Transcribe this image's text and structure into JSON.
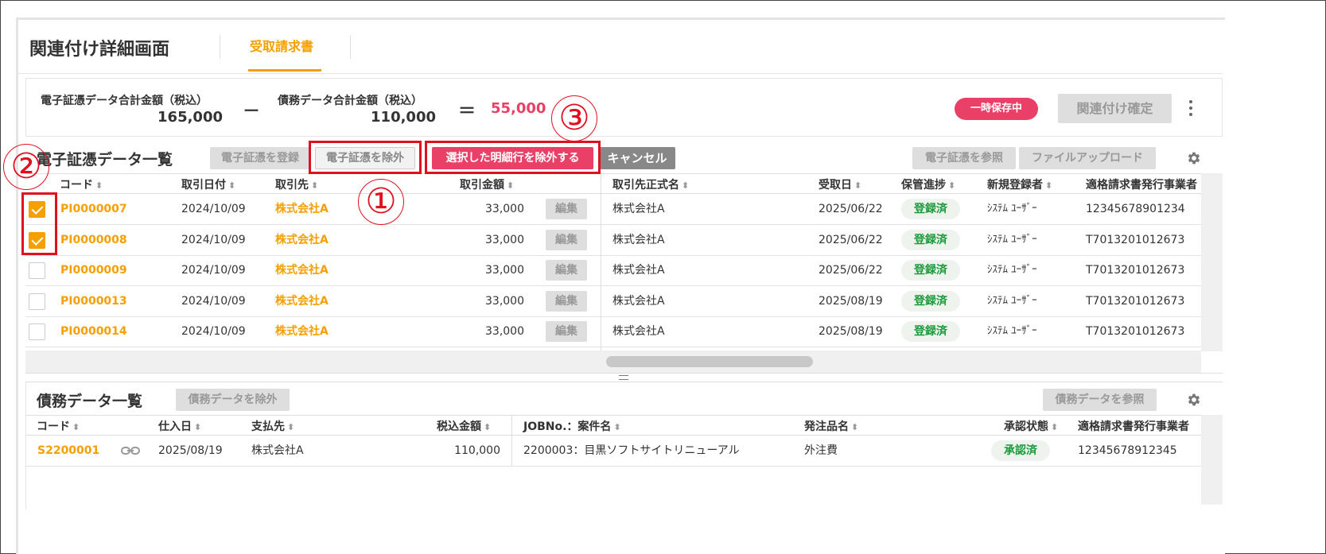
{
  "header": {
    "title": "関連付け詳細画面",
    "tab_label": "受取請求書"
  },
  "summary": {
    "evidence_label": "電子証憑データ合計金額（税込）",
    "evidence_value": "165,000",
    "minus": "－",
    "debt_label": "債務データ合計金額（税込）",
    "debt_value": "110,000",
    "equals": "＝",
    "difference": "55,000",
    "status_badge": "一時保存中",
    "confirm_button": "関連付け確定"
  },
  "evidence": {
    "title": "電子証憑データ一覧",
    "buttons": {
      "register": "電子証憑を登録",
      "exclude": "電子証憑を除外",
      "exclude_selected": "選択した明細行を除外する",
      "cancel": "キャンセル",
      "view": "電子証憑を参照",
      "upload": "ファイルアップロード"
    },
    "columns": [
      "コード",
      "取引日付",
      "取引先",
      "取引金額",
      "取引先正式名",
      "受取日",
      "保管進捗",
      "新規登録者",
      "適格請求書発行事業者"
    ],
    "edit_label": "編集",
    "rows": [
      {
        "checked": true,
        "code": "PI0000007",
        "date": "2024/10/09",
        "partner": "株式会社A",
        "amount": "33,000",
        "official": "株式会社A",
        "received": "2025/06/22",
        "status": "登録済",
        "registrant": "ｼｽﾃﾑ ﾕｰｻﾞｰ",
        "invoice_no": "12345678901234"
      },
      {
        "checked": true,
        "code": "PI0000008",
        "date": "2024/10/09",
        "partner": "株式会社A",
        "amount": "33,000",
        "official": "株式会社A",
        "received": "2025/06/22",
        "status": "登録済",
        "registrant": "ｼｽﾃﾑ ﾕｰｻﾞｰ",
        "invoice_no": "T7013201012673"
      },
      {
        "checked": false,
        "code": "PI0000009",
        "date": "2024/10/09",
        "partner": "株式会社A",
        "amount": "33,000",
        "official": "株式会社A",
        "received": "2025/06/22",
        "status": "登録済",
        "registrant": "ｼｽﾃﾑ ﾕｰｻﾞｰ",
        "invoice_no": "T7013201012673"
      },
      {
        "checked": false,
        "code": "PI0000013",
        "date": "2024/10/09",
        "partner": "株式会社A",
        "amount": "33,000",
        "official": "株式会社A",
        "received": "2025/08/19",
        "status": "登録済",
        "registrant": "ｼｽﾃﾑ ﾕｰｻﾞｰ",
        "invoice_no": "T7013201012673"
      },
      {
        "checked": false,
        "code": "PI0000014",
        "date": "2024/10/09",
        "partner": "株式会社A",
        "amount": "33,000",
        "official": "株式会社A",
        "received": "2025/08/19",
        "status": "登録済",
        "registrant": "ｼｽﾃﾑ ﾕｰｻﾞｰ",
        "invoice_no": "T7013201012673"
      }
    ]
  },
  "debt": {
    "title": "債務データ一覧",
    "buttons": {
      "exclude": "債務データを除外",
      "view": "債務データを参照"
    },
    "columns": [
      "コード",
      "仕入日",
      "支払先",
      "税込金額",
      "JOBNo.：案件名",
      "発注品名",
      "承認状態",
      "適格請求書発行事業者"
    ],
    "rows": [
      {
        "code": "S2200001",
        "date": "2025/08/19",
        "payee": "株式会社A",
        "amount": "110,000",
        "job": "2200003：目黒ソフトサイトリニューアル",
        "item": "外注費",
        "status": "承認済",
        "invoice_no": "12345678912345"
      }
    ]
  },
  "annotations": [
    "①",
    "②",
    "③"
  ],
  "colors": {
    "accent": "#f5a000",
    "alert": "#e84066",
    "annotation": "#e01020",
    "success": "#1a9a3a"
  }
}
